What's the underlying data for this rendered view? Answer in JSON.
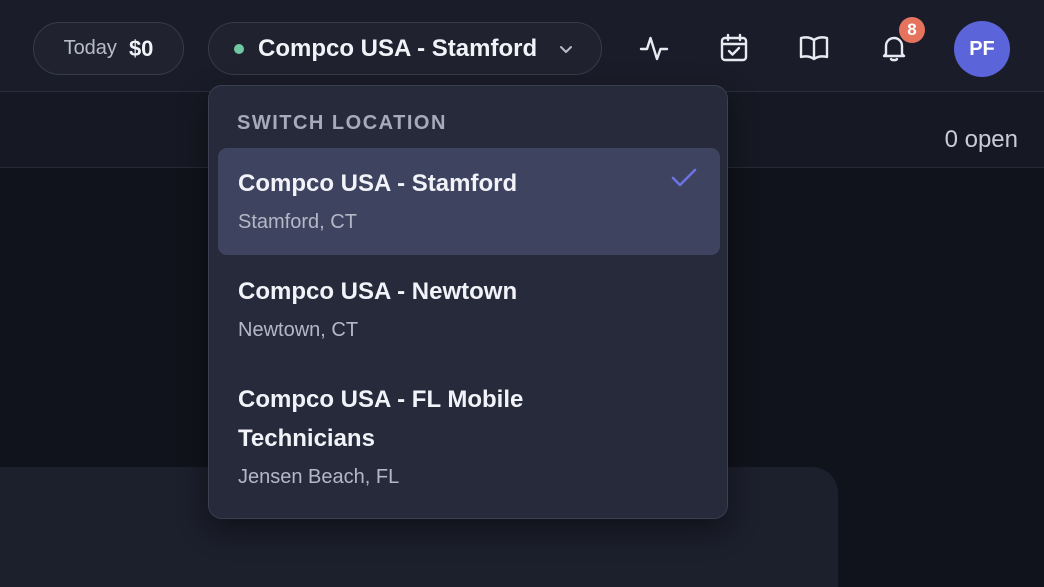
{
  "header": {
    "today_label": "Today",
    "today_amount": "$0",
    "current_location": "Compco USA - Stamford",
    "location_status_color": "#6fc8a2",
    "icons": [
      "activity-icon",
      "calendar-check-icon",
      "book-open-icon",
      "bell-icon"
    ],
    "notification_count": "8",
    "avatar_initials": "PF",
    "accent_color": "#5b64d8"
  },
  "subbar": {
    "open_count": "0 open"
  },
  "location_menu": {
    "header": "SWITCH LOCATION",
    "options": [
      {
        "name": "Compco USA - Stamford",
        "address": "Stamford, CT",
        "selected": true
      },
      {
        "name": "Compco USA - Newtown",
        "address": "Newtown, CT",
        "selected": false
      },
      {
        "name": "Compco USA - FL Mobile Technicians",
        "address": "Jensen Beach, FL",
        "selected": false
      }
    ]
  }
}
